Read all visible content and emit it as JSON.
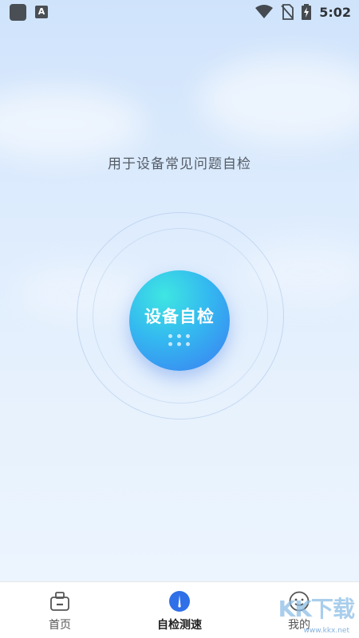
{
  "status_bar": {
    "time": "5:02",
    "notification_letter": "A",
    "icons": [
      "app-notification-icon",
      "a-notification-icon",
      "wifi-icon",
      "no-sim-icon",
      "battery-charging-icon"
    ]
  },
  "main": {
    "subtitle": "用于设备常见问题自检",
    "check_button_label": "设备自检"
  },
  "tabs": [
    {
      "label": "首页",
      "icon": "home-icon",
      "active": false
    },
    {
      "label": "自检测速",
      "icon": "speed-check-icon",
      "active": true
    },
    {
      "label": "我的",
      "icon": "profile-icon",
      "active": false
    }
  ],
  "colors": {
    "accent": "#3b7cf2",
    "accent_light": "#3ee6e2",
    "active_tab_icon": "#2f6fe8"
  },
  "watermark": {
    "text": "KK下载",
    "url": "www.kkx.net"
  }
}
